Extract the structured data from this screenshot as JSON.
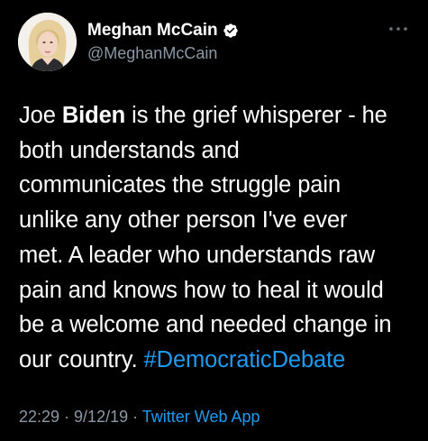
{
  "author": {
    "display_name": "Meghan McCain",
    "handle": "@MeghanMcCain",
    "verified_icon": "verified-badge-icon",
    "avatar_icon": "profile-photo"
  },
  "menu": {
    "more_icon": "more-options-icon"
  },
  "tweet": {
    "lines": [
      [
        "Joe ",
        "Biden",
        " is the grief whisperer - he"
      ],
      [
        "both understands and"
      ],
      [
        "communicates the struggle pain"
      ],
      [
        "unlike any other person I've ever"
      ],
      [
        "met. A leader who understands raw"
      ],
      [
        "pain and knows how to heal it would"
      ],
      [
        "be a welcome and needed change in"
      ],
      [
        "our country. ",
        "#DemocraticDebate"
      ]
    ]
  },
  "meta": {
    "time": "22:29",
    "separator": " · ",
    "date": "9/12/19",
    "source": "Twitter Web App"
  },
  "colors": {
    "background": "#000000",
    "text": "#ffffff",
    "secondary": "#8b98a5",
    "link": "#1d9bf0"
  }
}
